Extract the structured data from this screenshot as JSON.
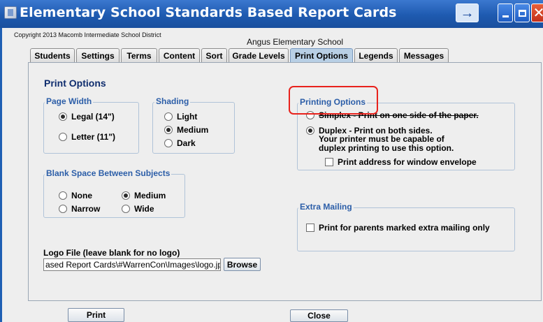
{
  "window": {
    "title": "Elementary School Standards Based Report Cards"
  },
  "header": {
    "copyright": "Copyright 2013 Macomb Intermediate School District",
    "school": "Angus Elementary School"
  },
  "tabs": [
    {
      "label": "Students"
    },
    {
      "label": "Settings"
    },
    {
      "label": "Terms"
    },
    {
      "label": "Content"
    },
    {
      "label": "Sort"
    },
    {
      "label": "Grade Levels"
    },
    {
      "label": "Print Options",
      "active": true
    },
    {
      "label": "Legends"
    },
    {
      "label": "Messages"
    }
  ],
  "panel": {
    "title": "Print Options",
    "page_width": {
      "label": "Page Width",
      "options": [
        {
          "label": "Legal (14\")",
          "selected": true
        },
        {
          "label": "Letter (11\")",
          "selected": false
        }
      ]
    },
    "shading": {
      "label": "Shading",
      "options": [
        {
          "label": "Light",
          "selected": false
        },
        {
          "label": "Medium",
          "selected": true
        },
        {
          "label": "Dark",
          "selected": false
        }
      ]
    },
    "blank_space": {
      "label": "Blank Space Between Subjects",
      "options": [
        {
          "label": "None",
          "selected": false
        },
        {
          "label": "Medium",
          "selected": true
        },
        {
          "label": "Narrow",
          "selected": false
        },
        {
          "label": "Wide",
          "selected": false
        }
      ]
    },
    "printing_options": {
      "label": "Printing Options",
      "simplex": "Simplex - Print on one side of the paper.",
      "duplex": "Duplex - Print on both sides.",
      "duplex_note_1": "Your printer must be capable of",
      "duplex_note_2": "duplex printing to use this option.",
      "window_envelope": "Print address for window envelope"
    },
    "extra_mailing": {
      "label": "Extra Mailing",
      "option": "Print for parents marked extra mailing only"
    },
    "logo": {
      "label": "Logo File  (leave blank for no logo)",
      "value": "ased Report Cards\\#WarrenCon\\Images\\logo.jpg",
      "browse": "Browse"
    }
  },
  "footer": {
    "print": "Print",
    "close": "Close"
  }
}
